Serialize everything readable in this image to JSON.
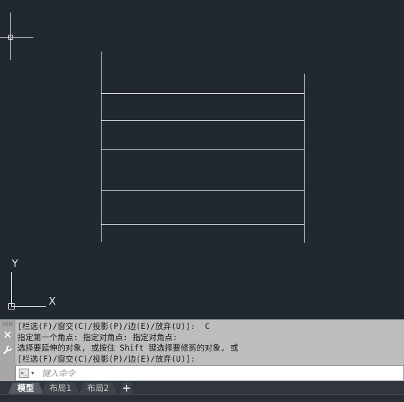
{
  "colors": {
    "canvas_bg": "#212830",
    "geometry": "#e6e6e6",
    "command_panel_bg": "#bdbdbd",
    "tabbar_bg": "#31363d"
  },
  "viewport": {
    "ucs_x_label": "X",
    "ucs_y_label": "Y",
    "crosshair_icon": "crosshair-cursor",
    "ucs_icon": "ucs-axes"
  },
  "command_line": {
    "gutter_icons": [
      "grip-icon",
      "close-icon",
      "wrench-icon"
    ],
    "history": [
      "[栏选(F)/窗交(C)/投影(P)/边(E)/放弃(U)]:  C",
      "指定第一个角点: 指定对角点: 指定对角点:",
      "选择要延伸的对象, 或按住 Shift 键选择要修剪的对象, 或",
      "[栏选(F)/窗交(C)/投影(P)/边(E)/放弃(U)]:"
    ],
    "prompt_icon": "command-prompt-icon",
    "input_value": "",
    "input_placeholder": "键入命令"
  },
  "layout_tabs": {
    "tabs": [
      "模型",
      "布局1",
      "布局2"
    ],
    "active": "模型",
    "add_label": "+"
  }
}
